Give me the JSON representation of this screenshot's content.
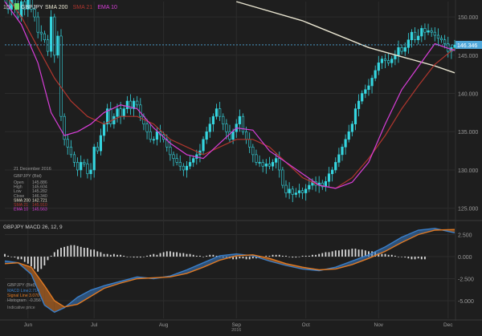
{
  "toolbar": {
    "period": "1D",
    "symbol": "GBPJPY"
  },
  "legend_price": [
    {
      "label": "SMA 200",
      "color": "#e8e4d0"
    },
    {
      "label": "SMA 21",
      "color": "#b0362e"
    },
    {
      "label": "EMA 10",
      "color": "#d83ed8"
    }
  ],
  "price_axis": {
    "ticks": [
      "150.000",
      "145.000",
      "140.000",
      "135.000",
      "130.000",
      "125.000"
    ],
    "current_value": "146.346"
  },
  "info_box": {
    "date": "21 December 2016",
    "instrument": "GBPJPY (Bid)",
    "rows": [
      {
        "k": "Open",
        "v": "145.886"
      },
      {
        "k": "High",
        "v": "145.604"
      },
      {
        "k": "Low",
        "v": "145.282"
      },
      {
        "k": "Close",
        "v": "146.340"
      },
      {
        "k": "SMA 200",
        "v": "142.721"
      },
      {
        "k": "SMA 21",
        "v": "145.910"
      },
      {
        "k": "EMA 10",
        "v": "145.563"
      }
    ]
  },
  "macd": {
    "title": "GBPJPY  MACD 26, 12, 9",
    "axis_ticks": [
      "2.500",
      "0.000",
      "-2.500",
      "-5.000"
    ],
    "info_instrument": "GBPJPY (Bid)",
    "info_rows": [
      {
        "k": "MACD Line",
        "v": "2.714"
      },
      {
        "k": "Signal Line",
        "v": "3.070"
      },
      {
        "k": "Histogram",
        "v": "-0.356"
      }
    ],
    "info_note": "Indicative price"
  },
  "time_axis": {
    "months": [
      "Jun",
      "Jul",
      "Aug",
      "Sep",
      "Oct",
      "Nov",
      "Dec"
    ],
    "year": "2016"
  },
  "colors": {
    "bg": "#1e1e1e",
    "grid": "#2c2c2c",
    "candle": "#35d6e0",
    "sma200": "#e8e4d0",
    "sma21": "#b0362e",
    "ema10": "#d83ed8",
    "macd_line": "#3a7ec8",
    "signal_line": "#e07a24",
    "histogram": "#d8d8d8",
    "price_tag": "#4fa7d9"
  },
  "chart_data": [
    {
      "type": "candlestick",
      "title": "GBPJPY",
      "x_label": "",
      "y_label": "",
      "ylim": [
        123.5,
        152
      ],
      "x_months": [
        "Jun",
        "Jul",
        "Aug",
        "Sep",
        "Oct",
        "Nov",
        "Dec"
      ],
      "x_month_index": [
        7,
        27,
        48,
        70,
        91,
        113,
        134
      ],
      "closes": [
        153,
        151,
        152.5,
        151.5,
        150,
        152,
        151,
        153,
        151,
        150,
        148,
        147.8,
        147,
        145.5,
        150,
        145,
        147.5,
        137,
        134,
        133,
        132,
        131,
        130,
        131,
        130.8,
        129.5,
        130,
        133,
        132.5,
        134.5,
        136,
        138,
        136,
        137,
        138,
        137,
        138,
        139,
        138,
        139,
        138.5,
        137,
        136,
        135,
        134,
        134,
        135,
        134.6,
        134,
        133,
        132,
        131.5,
        131,
        130.5,
        130,
        130.5,
        131,
        131.5,
        132,
        132.5,
        134,
        135,
        136,
        137,
        138,
        137,
        136,
        135,
        134,
        135,
        136,
        137,
        135,
        134,
        133,
        132,
        131,
        131,
        130.5,
        130.8,
        130.5,
        131,
        131.5,
        130,
        128,
        127,
        127.5,
        126.8,
        127,
        127.3,
        127,
        127.5,
        128,
        128.5,
        128,
        128.3,
        127.8,
        128.5,
        129.5,
        130,
        131,
        132,
        133,
        134,
        135,
        136,
        138,
        139,
        140,
        140.5,
        141,
        142,
        143,
        144,
        144.5,
        144.3,
        144,
        144.5,
        145,
        146,
        145.5,
        146,
        147,
        148,
        147,
        147.5,
        148.5,
        148,
        148.2,
        148,
        147.6,
        147.2,
        147,
        146.5,
        145.5,
        146,
        146.34
      ],
      "series": [
        {
          "name": "SMA 200",
          "points": [
            [
              70,
              152
            ],
            [
              90,
              149.5
            ],
            [
              110,
              146
            ],
            [
              130,
              143.6
            ],
            [
              136,
              142.7
            ]
          ]
        },
        {
          "name": "SMA 21",
          "points": [
            [
              0,
              153
            ],
            [
              5,
              150
            ],
            [
              10,
              146
            ],
            [
              15,
              142
            ],
            [
              20,
              139
            ],
            [
              25,
              137
            ],
            [
              30,
              136
            ],
            [
              35,
              137
            ],
            [
              40,
              137
            ],
            [
              45,
              136
            ],
            [
              50,
              134
            ],
            [
              55,
              133
            ],
            [
              60,
              132
            ],
            [
              65,
              133
            ],
            [
              70,
              134
            ],
            [
              75,
              134
            ],
            [
              80,
              133
            ],
            [
              85,
              131
            ],
            [
              90,
              129
            ],
            [
              95,
              128
            ],
            [
              100,
              127.6
            ],
            [
              105,
              129
            ],
            [
              110,
              131.5
            ],
            [
              115,
              134.5
            ],
            [
              120,
              138
            ],
            [
              125,
              141
            ],
            [
              130,
              143.8
            ],
            [
              136,
              145.9
            ]
          ]
        },
        {
          "name": "EMA 10",
          "points": [
            [
              0,
              152
            ],
            [
              5,
              149
            ],
            [
              10,
              144
            ],
            [
              14,
              137.5
            ],
            [
              18,
              134.5
            ],
            [
              22,
              135
            ],
            [
              26,
              136
            ],
            [
              30,
              137.5
            ],
            [
              35,
              138.5
            ],
            [
              40,
              138
            ],
            [
              45,
              135.5
            ],
            [
              50,
              133.5
            ],
            [
              55,
              132
            ],
            [
              60,
              131.5
            ],
            [
              65,
              133.5
            ],
            [
              70,
              135.5
            ],
            [
              75,
              135.2
            ],
            [
              80,
              132.5
            ],
            [
              85,
              131
            ],
            [
              90,
              129.5
            ],
            [
              95,
              128
            ],
            [
              100,
              127.6
            ],
            [
              105,
              128.4
            ],
            [
              110,
              131
            ],
            [
              115,
              136
            ],
            [
              120,
              140.5
            ],
            [
              125,
              143.5
            ],
            [
              130,
              146.5
            ],
            [
              136,
              145.6
            ]
          ]
        }
      ]
    },
    {
      "type": "line",
      "title": "GBPJPY  MACD 26, 12, 9",
      "x_label": "",
      "y_label": "",
      "ylim": [
        -7,
        4
      ],
      "series": [
        {
          "name": "MACD Line",
          "points": [
            [
              0,
              -0.5
            ],
            [
              4,
              -0.7
            ],
            [
              8,
              -2
            ],
            [
              12,
              -5.5
            ],
            [
              15,
              -6.3
            ],
            [
              18,
              -5.8
            ],
            [
              22,
              -4.6
            ],
            [
              26,
              -3.8
            ],
            [
              30,
              -3.3
            ],
            [
              35,
              -2.8
            ],
            [
              40,
              -2.3
            ],
            [
              45,
              -2.5
            ],
            [
              50,
              -2.2
            ],
            [
              55,
              -1.5
            ],
            [
              60,
              -0.7
            ],
            [
              65,
              0.1
            ],
            [
              70,
              0.3
            ],
            [
              75,
              0.1
            ],
            [
              80,
              -0.5
            ],
            [
              85,
              -1
            ],
            [
              90,
              -1.4
            ],
            [
              95,
              -1.6
            ],
            [
              100,
              -1.2
            ],
            [
              105,
              -0.5
            ],
            [
              110,
              0.2
            ],
            [
              115,
              1.1
            ],
            [
              120,
              2.2
            ],
            [
              125,
              3
            ],
            [
              130,
              3.2
            ],
            [
              136,
              2.7
            ]
          ]
        },
        {
          "name": "Signal Line",
          "points": [
            [
              0,
              -0.8
            ],
            [
              4,
              -0.7
            ],
            [
              8,
              -1.2
            ],
            [
              12,
              -3.3
            ],
            [
              15,
              -5
            ],
            [
              18,
              -5.7
            ],
            [
              22,
              -5.4
            ],
            [
              26,
              -4.5
            ],
            [
              30,
              -3.6
            ],
            [
              35,
              -3
            ],
            [
              40,
              -2.5
            ],
            [
              45,
              -2.4
            ],
            [
              50,
              -2.3
            ],
            [
              55,
              -1.9
            ],
            [
              60,
              -1.2
            ],
            [
              65,
              -0.4
            ],
            [
              70,
              0.1
            ],
            [
              75,
              0.2
            ],
            [
              80,
              -0.2
            ],
            [
              85,
              -0.8
            ],
            [
              90,
              -1.2
            ],
            [
              95,
              -1.5
            ],
            [
              100,
              -1.4
            ],
            [
              105,
              -0.9
            ],
            [
              110,
              -0.2
            ],
            [
              115,
              0.6
            ],
            [
              120,
              1.6
            ],
            [
              125,
              2.5
            ],
            [
              130,
              3
            ],
            [
              136,
              3.07
            ]
          ]
        }
      ],
      "histogram": [
        0.3,
        0.1,
        0,
        -0.1,
        -0.3,
        -0.3,
        -0.6,
        -0.8,
        -1.1,
        -1.4,
        -1.7,
        -1.4,
        -1,
        -0.4,
        0.1,
        0.5,
        0.8,
        1,
        1.1,
        1.2,
        1.3,
        1.3,
        1.2,
        1.1,
        1,
        1,
        0.8,
        0.8,
        0.6,
        0.5,
        0.3,
        0.3,
        0.2,
        0.3,
        0.2,
        0.2,
        0.1,
        0,
        0,
        -0.1,
        -0.1,
        -0.1,
        0,
        0.1,
        0.2,
        0.3,
        0.2,
        0.4,
        0.5,
        0.6,
        0.6,
        0.5,
        0.5,
        0.4,
        0.4,
        0.3,
        0.3,
        0.2,
        0.1,
        0.1,
        0,
        0.1,
        0.2,
        0.2,
        0.1,
        0,
        -0.1,
        -0.1,
        -0.2,
        -0.3,
        -0.3,
        -0.2,
        -0.2,
        -0.3,
        -0.3,
        -0.2,
        -0.2,
        -0.1,
        0,
        0.1,
        0.1,
        0.2,
        0.2,
        0.2,
        0.1,
        0.1,
        0,
        -0.1,
        -0.1,
        0,
        0.1,
        0.1,
        0.1,
        0.2,
        0.2,
        0.3,
        0.4,
        0.5,
        0.5,
        0.6,
        0.7,
        0.7,
        0.8,
        0.8,
        0.8,
        0.9,
        0.9,
        0.8,
        0.8,
        0.7,
        0.6,
        0.6,
        0.5,
        0.4,
        0.3,
        0.3,
        0.2,
        0.2,
        0.1,
        0,
        0,
        -0.1,
        -0.2,
        -0.3,
        -0.3,
        -0.2,
        -0.3,
        -0.3
      ]
    }
  ]
}
